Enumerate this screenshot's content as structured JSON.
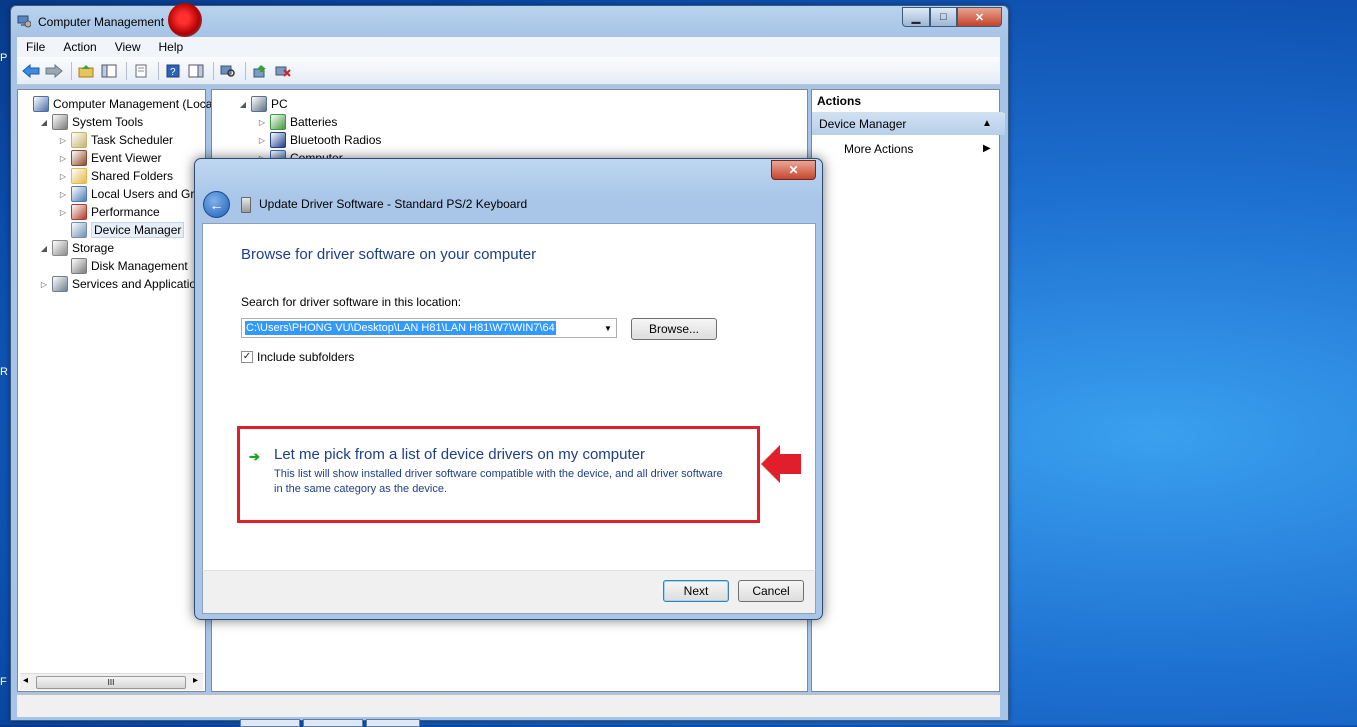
{
  "main_window": {
    "title": "Computer Management",
    "controls": {
      "minimize": "▁",
      "maximize": "□",
      "close": "✕"
    }
  },
  "menu": [
    "File",
    "Action",
    "View",
    "Help"
  ],
  "toolbar_icons": [
    "back-icon",
    "forward-icon",
    "up-folder-icon",
    "show-hide-tree-icon",
    "properties-icon",
    "help-icon",
    "show-action-pane-icon",
    "scan-hardware-icon",
    "update-driver-icon",
    "uninstall-icon"
  ],
  "left_tree": [
    {
      "label": "Computer Management (Local",
      "level": 0,
      "expander": "",
      "icon": "computer-management-icon",
      "color": "#4a6fa5"
    },
    {
      "label": "System Tools",
      "level": 1,
      "expander": "◢",
      "icon": "system-tools-icon",
      "color": "#7a7a7a"
    },
    {
      "label": "Task Scheduler",
      "level": 2,
      "expander": "▷",
      "icon": "clock-icon",
      "color": "#c7b26d"
    },
    {
      "label": "Event Viewer",
      "level": 2,
      "expander": "▷",
      "icon": "event-viewer-icon",
      "color": "#8c4a2b"
    },
    {
      "label": "Shared Folders",
      "level": 2,
      "expander": "▷",
      "icon": "shared-folder-icon",
      "color": "#e4b84a"
    },
    {
      "label": "Local Users and Group",
      "level": 2,
      "expander": "▷",
      "icon": "users-icon",
      "color": "#4d7ab8"
    },
    {
      "label": "Performance",
      "level": 2,
      "expander": "▷",
      "icon": "performance-icon",
      "color": "#b03a2e"
    },
    {
      "label": "Device Manager",
      "level": 2,
      "expander": "",
      "icon": "device-manager-icon",
      "color": "#6f8fb3",
      "selected": true
    },
    {
      "label": "Storage",
      "level": 1,
      "expander": "◢",
      "icon": "storage-icon",
      "color": "#8a8a8a"
    },
    {
      "label": "Disk Management",
      "level": 2,
      "expander": "",
      "icon": "disk-icon",
      "color": "#7c7c7c"
    },
    {
      "label": "Services and Applications",
      "level": 1,
      "expander": "▷",
      "icon": "services-icon",
      "color": "#6f7f8f"
    }
  ],
  "left_scroll": {
    "left": "◂",
    "thumb": "III",
    "right": "▸"
  },
  "device_tree": [
    {
      "label": "PC",
      "level": 0,
      "expander": "◢",
      "icon": "pc-icon",
      "color": "#5b6f86"
    },
    {
      "label": "Batteries",
      "level": 1,
      "expander": "▷",
      "icon": "battery-icon",
      "color": "#3f9a3f"
    },
    {
      "label": "Bluetooth Radios",
      "level": 1,
      "expander": "▷",
      "icon": "bluetooth-icon",
      "color": "#1f3f8f"
    },
    {
      "label": "Computer",
      "level": 1,
      "expander": "▷",
      "icon": "computer-icon",
      "color": "#3a6cb0"
    }
  ],
  "actions": {
    "header": "Actions",
    "section": "Device Manager",
    "section_caret": "▲",
    "more": "More Actions",
    "more_caret": "▶"
  },
  "dialog": {
    "title": "Update Driver Software - Standard PS/2 Keyboard",
    "close": "✕",
    "back": "←",
    "heading": "Browse for driver software on your computer",
    "search_label": "Search for driver software in this location:",
    "path_value": "C:\\Users\\PHONG VU\\Desktop\\LAN H81\\LAN H81\\W7\\WIN7\\64",
    "dropdown": "▼",
    "browse": "Browse...",
    "include_subfolders": "Include subfolders",
    "checkbox_mark": "✓",
    "pick_arrow": "➔",
    "pick_title": "Let me pick from a list of device drivers on my computer",
    "pick_desc": "This list will show installed driver software compatible with the device, and all driver software in the same category as the device.",
    "next": "Next",
    "cancel": "Cancel"
  },
  "colors": {
    "highlight_box": "#e01f2a",
    "link_blue": "#1e3f87",
    "pointer_arrow": "#e01f2a"
  }
}
